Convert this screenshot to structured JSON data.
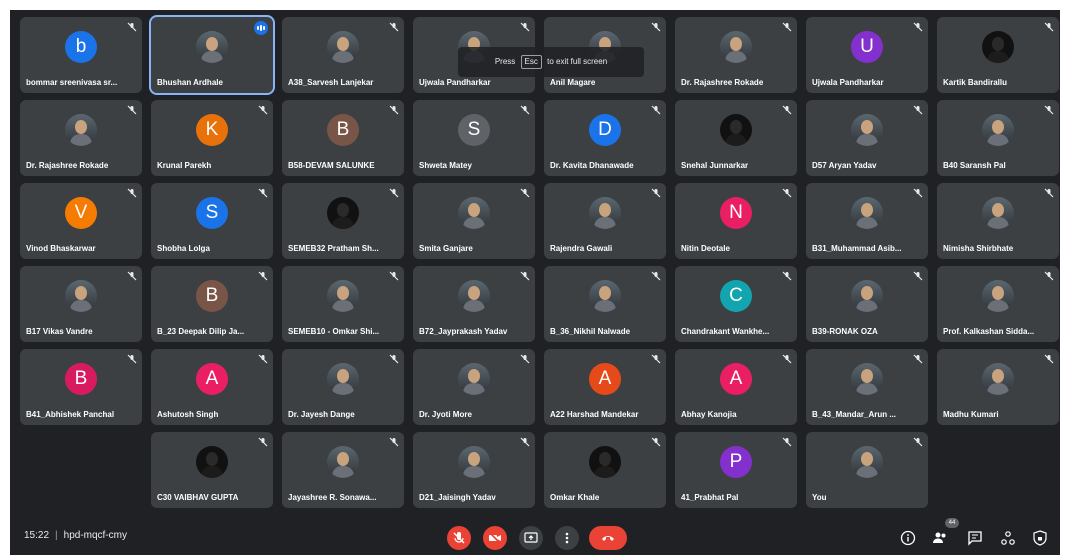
{
  "toast": {
    "prefix": "Press",
    "key": "Esc",
    "suffix": "to exit full screen"
  },
  "participants": [
    {
      "name": "bommar sreenivasa sr...",
      "initial": "b",
      "color": "#1a73e8"
    },
    {
      "name": "Bhushan Ardhale",
      "photo": true,
      "active": true
    },
    {
      "name": "A38_Sarvesh Lanjekar",
      "photo": true
    },
    {
      "name": "Ujwala Pandharkar",
      "photo": true
    },
    {
      "name": "Anil Magare",
      "photo": true
    },
    {
      "name": "Dr. Rajashree Rokade",
      "photo": true
    },
    {
      "name": "Ujwala Pandharkar",
      "initial": "U",
      "color": "#8430ce"
    },
    {
      "name": "Kartik Bandirallu",
      "photo": true,
      "dark": true
    },
    {
      "name": "Dr. Rajashree Rokade",
      "photo": true
    },
    {
      "name": "Krunal Parekh",
      "initial": "K",
      "color": "#e8710a"
    },
    {
      "name": "B58-DEVAM SALUNKE",
      "initial": "B",
      "color": "#795548"
    },
    {
      "name": "Shweta Matey",
      "initial": "S",
      "color": "#5f6368"
    },
    {
      "name": "Dr. Kavita Dhanawade",
      "initial": "D",
      "color": "#1a73e8"
    },
    {
      "name": "Snehal Junnarkar",
      "photo": true,
      "dark": true
    },
    {
      "name": "D57 Aryan Yadav",
      "photo": true
    },
    {
      "name": "B40 Saransh Pal",
      "photo": true
    },
    {
      "name": "Vinod Bhaskarwar",
      "initial": "V",
      "color": "#f57c00"
    },
    {
      "name": "Shobha Lolga",
      "initial": "S",
      "color": "#1a73e8"
    },
    {
      "name": "SEMEB32 Pratham Sh...",
      "photo": true,
      "dark": true
    },
    {
      "name": "Smita Ganjare",
      "photo": true
    },
    {
      "name": "Rajendra Gawali",
      "photo": true
    },
    {
      "name": "Nitin Deotale",
      "initial": "N",
      "color": "#e91e63"
    },
    {
      "name": "B31_Muhammad Asib...",
      "photo": true
    },
    {
      "name": "Nimisha Shirbhate",
      "photo": true
    },
    {
      "name": "B17 Vikas Vandre",
      "photo": true
    },
    {
      "name": "B_23 Deepak Dilip Ja...",
      "initial": "B",
      "color": "#795548"
    },
    {
      "name": "SEMEB10 - Omkar Shi...",
      "photo": true
    },
    {
      "name": "B72_Jayprakash Yadav",
      "photo": true
    },
    {
      "name": "B_36_Nikhil Nalwade",
      "photo": true
    },
    {
      "name": "Chandrakant Wankhe...",
      "initial": "C",
      "color": "#12a4af"
    },
    {
      "name": "B39-RONAK OZA",
      "photo": true
    },
    {
      "name": "Prof. Kalkashan Sidda...",
      "photo": true
    },
    {
      "name": "B41_Abhishek Panchal",
      "initial": "B",
      "color": "#d81b60"
    },
    {
      "name": "Ashutosh Singh",
      "initial": "A",
      "color": "#e91e63"
    },
    {
      "name": "Dr. Jayesh Dange",
      "photo": true
    },
    {
      "name": "Dr. Jyoti More",
      "photo": true
    },
    {
      "name": "A22 Harshad Mandekar",
      "initial": "A",
      "color": "#e64a19"
    },
    {
      "name": "Abhay Kanojia",
      "initial": "A",
      "color": "#e91e63"
    },
    {
      "name": "B_43_Mandar_Arun ...",
      "photo": true
    },
    {
      "name": "Madhu Kumari",
      "photo": true
    },
    {
      "name": "C30 VAIBHAV GUPTA",
      "photo": true,
      "dark": true
    },
    {
      "name": "Jayashree R. Sonawa...",
      "photo": true
    },
    {
      "name": "D21_Jaisingh Yadav",
      "photo": true
    },
    {
      "name": "Omkar Khale",
      "photo": true,
      "dark": true
    },
    {
      "name": "41_Prabhat Pal",
      "initial": "P",
      "color": "#8430ce"
    },
    {
      "name": "You",
      "photo": true
    }
  ],
  "footer": {
    "time": "15:22",
    "separator": "|",
    "meeting_code": "hpd-mqcf-cmy",
    "participant_count": "44",
    "colors": {
      "end_call": "#ea4335",
      "muted": "#ea4335",
      "control": "#3c4043"
    }
  }
}
